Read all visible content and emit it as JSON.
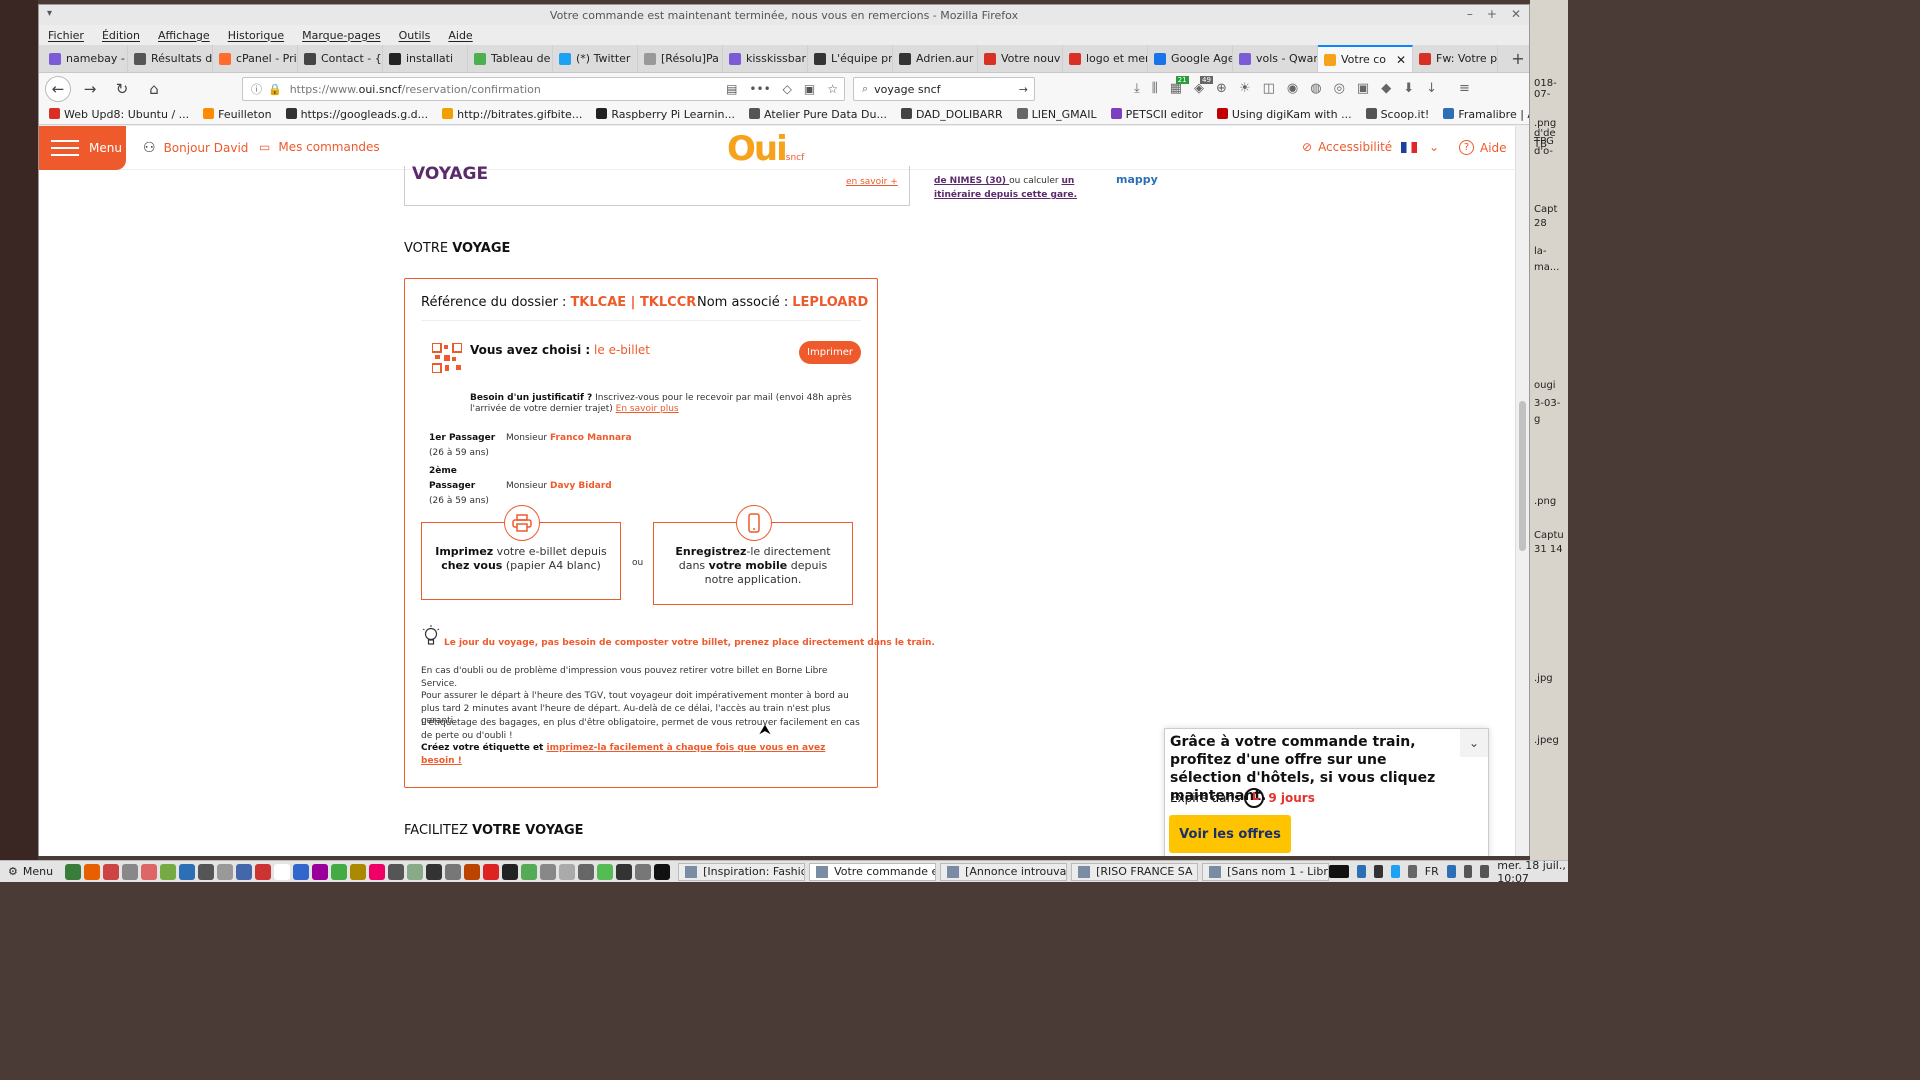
{
  "window": {
    "title": "Votre commande est maintenant terminée, nous vous en remercions - Mozilla Firefox"
  },
  "menubar": [
    "Fichier",
    "Édition",
    "Affichage",
    "Historique",
    "Marque-pages",
    "Outils",
    "Aide"
  ],
  "tabs": [
    {
      "label": "namebay -",
      "color": "#7b5cd6"
    },
    {
      "label": "Résultats d",
      "color": "#555555"
    },
    {
      "label": "cPanel - Princip",
      "color": "#ff6c2c"
    },
    {
      "label": "Contact - {",
      "color": "#444444"
    },
    {
      "label": "installati",
      "color": "#222222"
    },
    {
      "label": "Tableau de",
      "color": "#4caf50"
    },
    {
      "label": "(*) Twitter",
      "color": "#1da1f2"
    },
    {
      "label": "[Résolu]Pa",
      "color": "#999999"
    },
    {
      "label": "kisskissbar",
      "color": "#7b5cd6"
    },
    {
      "label": "L'équipe pr",
      "color": "#333333"
    },
    {
      "label": "Adrien.aur",
      "color": "#333333"
    },
    {
      "label": "Votre nouv",
      "color": "#d93025"
    },
    {
      "label": "logo et mer",
      "color": "#d93025"
    },
    {
      "label": "Google Age",
      "color": "#1a73e8"
    },
    {
      "label": "vols - Qwar",
      "color": "#7b5cd6"
    },
    {
      "label": "Votre co",
      "color": "#f7a21b",
      "active": true
    },
    {
      "label": "Fw: Votre p",
      "color": "#d93025"
    }
  ],
  "nav": {
    "url_prefix": "https://www.",
    "url_host": "oui.sncf",
    "url_path": "/reservation/confirmation",
    "search_value": "voyage sncf",
    "badge_1": "21",
    "badge_2": "49"
  },
  "bookmarks": [
    {
      "label": "Web Upd8: Ubuntu / ...",
      "color": "#d93025"
    },
    {
      "label": "Feuilleton",
      "color": "#ff8c00"
    },
    {
      "label": "https://googleads.g.d...",
      "color": "#333333"
    },
    {
      "label": "http://bitrates.gifbite...",
      "color": "#f0a000"
    },
    {
      "label": "Raspberry Pi Learnin...",
      "color": "#222222"
    },
    {
      "label": "Atelier Pure Data Du...",
      "color": "#555555"
    },
    {
      "label": "DAD_DOLIBARR",
      "color": "#444444"
    },
    {
      "label": "LIEN_GMAIL",
      "color": "#666666"
    },
    {
      "label": "PETSCII editor",
      "color": "#7b3fbf"
    },
    {
      "label": "Using digiKam with ...",
      "color": "#c00000"
    },
    {
      "label": "Scoop.it!",
      "color": "#555555"
    },
    {
      "label": "Framalibre | Annuair...",
      "color": "#2c6fb5"
    }
  ],
  "site": {
    "menu_label": "Menu",
    "greeting": "Bonjour David",
    "orders": "Mes commandes",
    "logo_main": "Oui",
    "logo_sub": "sncf",
    "accessibility": "Accessibilité",
    "help": "Aide"
  },
  "prev": {
    "title": "VOYAGE",
    "link": "en savoir +",
    "side_bold_1": "de NIMES (30) ",
    "side_text": "ou calculer ",
    "side_bold_2": "un itinéraire depuis cette gare.",
    "mappy": "mappy"
  },
  "section": {
    "title_light": "VOTRE ",
    "title_bold": "VOYAGE"
  },
  "card": {
    "ref_label": "Référence du dossier :",
    "ref_value": "TKLCAE | TKLCCR",
    "name_label": "Nom associé :",
    "name_value": "LEPLOARD",
    "chosen_label": "Vous avez choisi :",
    "chosen_value": "le e-billet",
    "print_button": "Imprimer",
    "justif_bold": "Besoin d'un justificatif ?",
    "justif_text": " Inscrivez-vous pour le recevoir par mail (envoi 48h après l'arrivée de votre dernier trajet) ",
    "justif_link": "En savoir plus",
    "passengers": [
      {
        "label": "1er Passager",
        "civility": "Monsieur",
        "name": "Franco Mannara",
        "age": "(26 à 59 ans)"
      },
      {
        "label": "2ème Passager",
        "civility": "Monsieur",
        "name": "Davy Bidard",
        "age": "(26 à 59 ans)"
      }
    ],
    "opt1_b1": "Imprimez",
    "opt1_t1": " votre e-billet depuis ",
    "opt1_b2": "chez vous",
    "opt1_t2": " (papier A4 blanc)",
    "or": "ou",
    "opt2_b1": "Enregistrez",
    "opt2_t1": "-le directement dans ",
    "opt2_b2": "votre mobile",
    "opt2_t2": " depuis notre application.",
    "tip": "Le jour du voyage, pas besoin de composter votre billet, prenez place directement dans le train.",
    "info1": "En cas d'oubli ou de problème d'impression vous pouvez retirer votre billet en Borne Libre Service.",
    "info2": "Pour assurer le départ à l'heure des TGV, tout voyageur doit impérativement monter à bord au plus tard 2 minutes avant l'heure de départ. Au-delà de ce délai, l'accès au train n'est plus garanti.",
    "info3": "L'étiquetage des bagages, en plus d'être obligatoire, permet de vous retrouver facilement en cas de perte ou d'oubli !",
    "info4_bold": "Créez votre étiquette et ",
    "info4_link": "imprimez-la facilement à chaque fois que vous en avez besoin !"
  },
  "section2": {
    "title_light": "FACILITEZ ",
    "title_bold": "VOTRE VOYAGE"
  },
  "promo": {
    "title": "Grâce à votre commande train, profitez d'une offre sur une sélection d'hôtels, si vous cliquez maintenant.",
    "expires": "Expire dans",
    "days": "9 jours",
    "button": "Voir les offres"
  },
  "desktop_labels": [
    "018-07-",
    ".png",
    "d'de TB",
    "TPG",
    "d'o-",
    "Capt",
    "28",
    "la-",
    "ma...",
    "ougi",
    "3-03-",
    "g",
    ".png",
    "Captu",
    "31 14",
    ".jpg",
    ".jpeg"
  ],
  "taskbar": {
    "start": "Menu",
    "tasks": [
      {
        "label": "[Inspiration: Fashio...",
        "active": false
      },
      {
        "label": "Votre commande e...",
        "active": true
      },
      {
        "label": "[Annonce introuva...",
        "active": false
      },
      {
        "label": "[RISO FRANCE SA (...",
        "active": false
      },
      {
        "label": "[Sans nom 1 - Libre...",
        "active": false
      }
    ],
    "lang": "FR",
    "clock": "mer. 18 juil., 10:07"
  }
}
